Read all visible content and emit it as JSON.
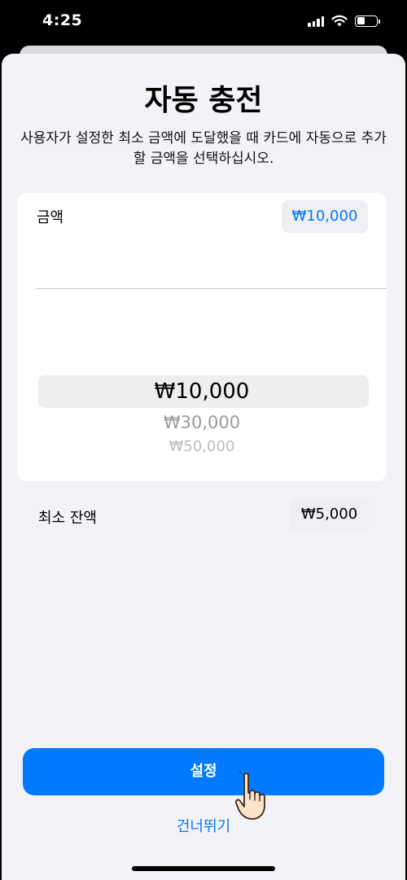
{
  "status_bar": {
    "time": "4:25",
    "icons": [
      "signal-icon",
      "wifi-icon",
      "battery-icon"
    ]
  },
  "sheet": {
    "title": "자동 충전",
    "description": "사용자가 설정한 최소 금액에 도달했을 때 카드에 자동으로 추가할 금액을 선택하십시오."
  },
  "amount_row": {
    "label": "금액",
    "value": "₩10,000"
  },
  "picker": {
    "options": [
      "₩10,000",
      "₩30,000",
      "₩50,000"
    ],
    "selected": "₩10,000"
  },
  "min_balance_row": {
    "label": "최소 잔액",
    "value": "₩5,000"
  },
  "actions": {
    "primary_label": "설정",
    "skip_label": "건너뛰기"
  },
  "colors": {
    "accent": "#007aff",
    "background": "#f2f2f7",
    "card": "#ffffff"
  }
}
